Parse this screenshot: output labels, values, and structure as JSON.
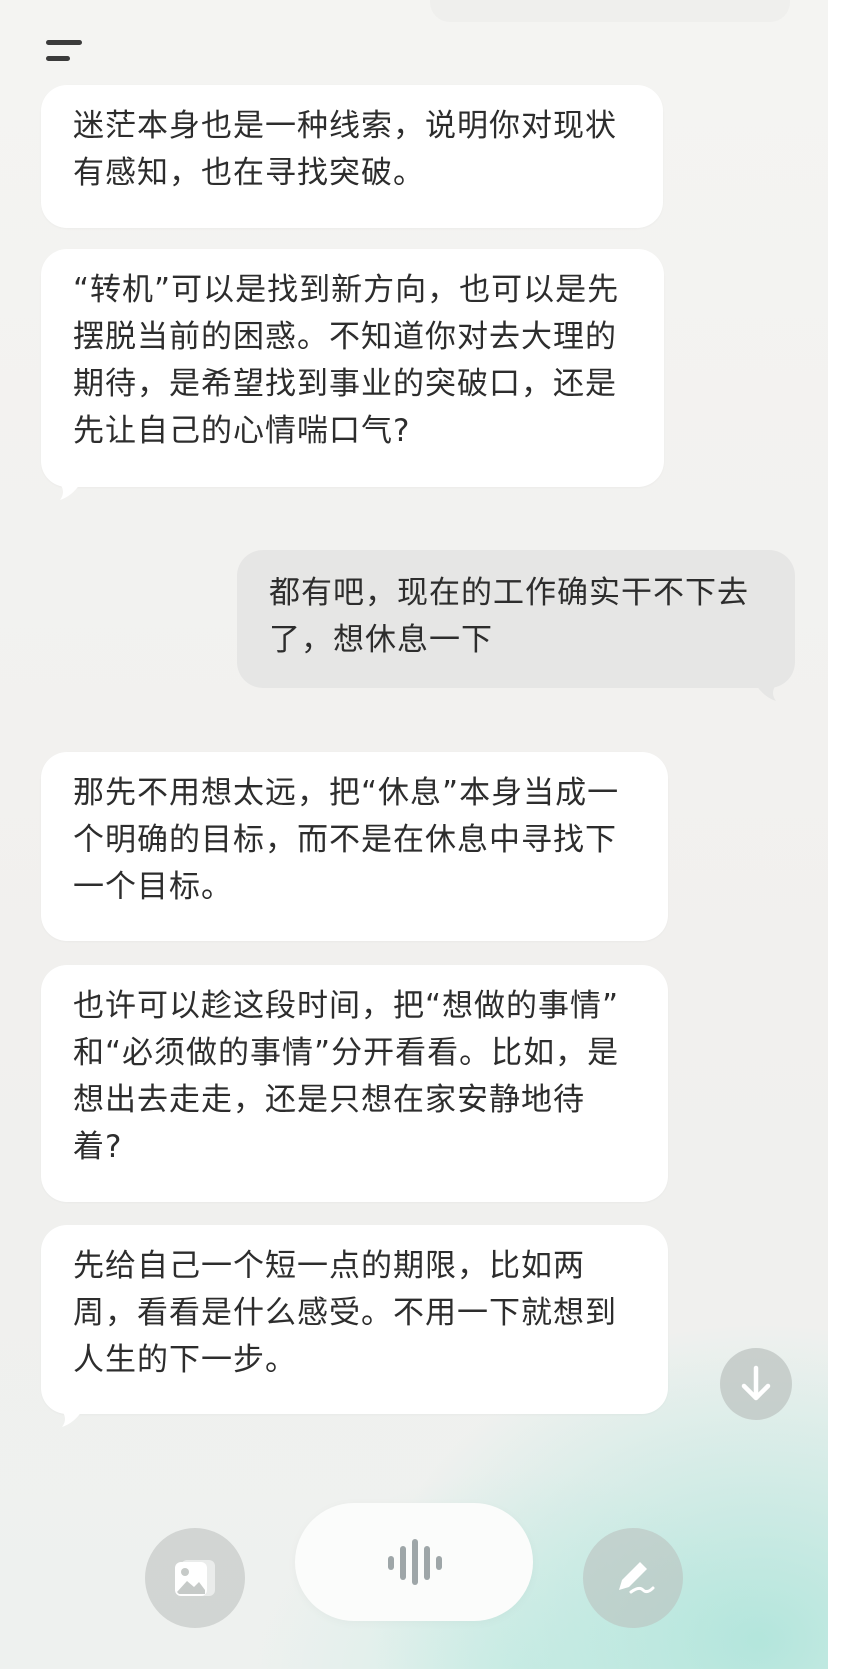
{
  "header": {
    "menu_icon": "menu-icon"
  },
  "messages": [
    {
      "role": "assistant",
      "text": "迷茫本身也是一种线索，说明你对现状\n有感知，也在寻找突破。"
    },
    {
      "role": "assistant",
      "text": "“转机”可以是找到新方向，也可以是先\n摆脱当前的困惑。不知道你对去大理的\n期待，是希望找到事业的突破口，还是\n先让自己的心情喘口气?"
    },
    {
      "role": "user",
      "text": "都有吧，现在的工作确实干不下去\n了，想休息一下"
    },
    {
      "role": "assistant",
      "text": "那先不用想太远，把“休息”本身当成一\n个明确的目标，而不是在休息中寻找下\n一个目标。"
    },
    {
      "role": "assistant",
      "text": "也许可以趁这段时间，把“想做的事情”\n和“必须做的事情”分开看看。比如，是\n想出去走走，还是只想在家安静地待\n着?"
    },
    {
      "role": "assistant",
      "text": "先给自己一个短一点的期限，比如两\n周，看看是什么感受。不用一下就想到\n人生的下一步。"
    }
  ],
  "controls": {
    "scroll_down_icon": "arrow-down-icon",
    "image_icon": "image-icon",
    "voice_icon": "voice-wave-icon",
    "edit_icon": "pen-icon"
  },
  "colors": {
    "background": "#f1f0ee",
    "assistant_bubble": "#ffffff",
    "user_bubble": "#e6e6e5",
    "text": "#2d2d2d",
    "accent_gradient": "#a0e2d6"
  }
}
